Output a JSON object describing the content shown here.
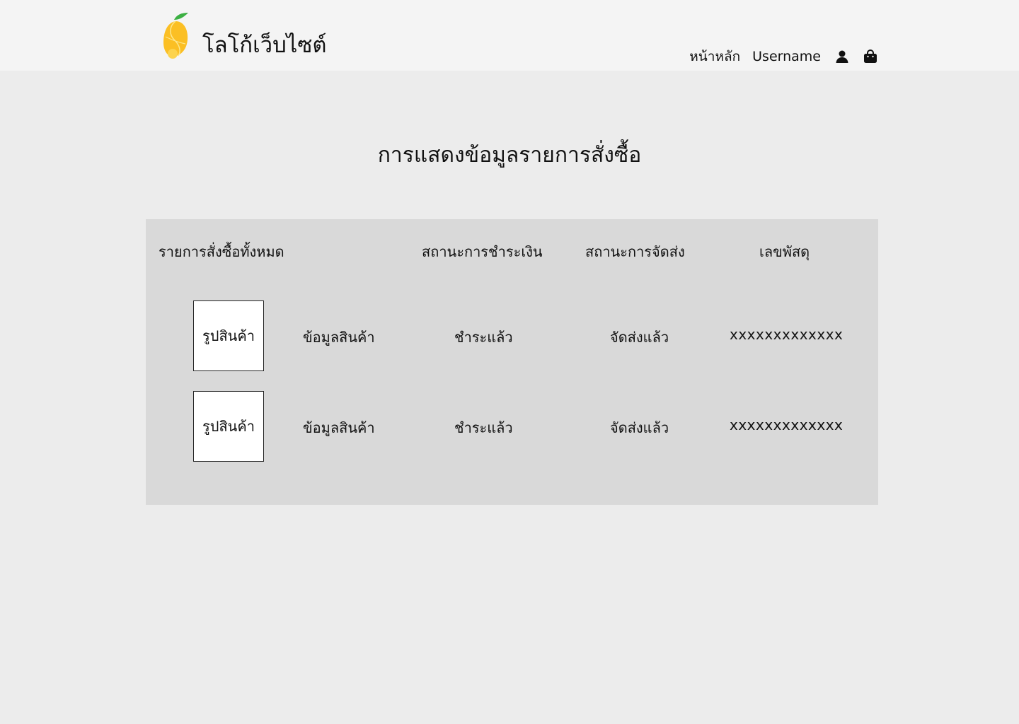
{
  "header": {
    "logo_text": "โลโก้เว็บไซต์",
    "logo_icon": "mango-logo-icon",
    "nav": {
      "home_label": "หน้าหลัก",
      "username_label": "Username",
      "profile_icon": "user-icon",
      "cart_icon": "shopping-bag-icon"
    }
  },
  "main": {
    "title": "การแสดงข้อมูลรายการสั่งซื้อ",
    "table": {
      "headers": {
        "orders": "รายการสั่งซื้อทั้งหมด",
        "payment_status": "สถานะการชำระเงิน",
        "shipping_status": "สถานะการจัดส่ง",
        "tracking_number": "เลขพัสดุ"
      },
      "rows": [
        {
          "image_label": "รูปสินค้า",
          "product_info": "ข้อมูลสินค้า",
          "payment_status": "ชำระแล้ว",
          "shipping_status": "จัดส่งแล้ว",
          "tracking_number": "xxxxxxxxxxxxx"
        },
        {
          "image_label": "รูปสินค้า",
          "product_info": "ข้อมูลสินค้า",
          "payment_status": "ชำระแล้ว",
          "shipping_status": "จัดส่งแล้ว",
          "tracking_number": "xxxxxxxxxxxxx"
        }
      ]
    }
  },
  "colors": {
    "header_bg": "#f4f4f4",
    "page_bg": "#ececec",
    "panel_bg": "#d9d9d9",
    "logo_leaf": "#3cb043",
    "logo_mango": "#fbbf24"
  }
}
